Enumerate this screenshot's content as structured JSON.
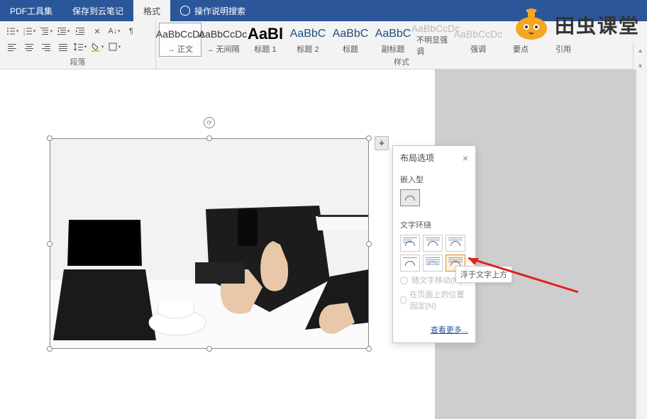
{
  "tabs": {
    "pdf_tools": "PDF工具集",
    "save_cloud": "保存到云笔记",
    "format": "格式",
    "search_placeholder": "操作说明搜索"
  },
  "ribbon": {
    "paragraph_label": "段落",
    "styles_label": "样式",
    "styles": [
      {
        "sample": "AaBbCcDc",
        "name": "→ 正文",
        "selected": true,
        "cls": ""
      },
      {
        "sample": "AaBbCcDc",
        "name": "→ 无间隔",
        "selected": false,
        "cls": ""
      },
      {
        "sample": "AaBl",
        "name": "标题 1",
        "selected": false,
        "cls": "big"
      },
      {
        "sample": "AaBbC",
        "name": "标题 2",
        "selected": false,
        "cls": "med"
      },
      {
        "sample": "AaBbC",
        "name": "标题",
        "selected": false,
        "cls": "med"
      },
      {
        "sample": "AaBbC",
        "name": "副标题",
        "selected": false,
        "cls": "med"
      },
      {
        "sample": "AaBbCcDc",
        "name": "不明显强调",
        "selected": false,
        "cls": "gray"
      },
      {
        "sample": "AaBbCcDc",
        "name": "强调",
        "selected": false,
        "cls": "gray"
      },
      {
        "sample": "",
        "name": "要点",
        "selected": false,
        "cls": "gray"
      },
      {
        "sample": "",
        "name": "引用",
        "selected": false,
        "cls": "gray"
      }
    ]
  },
  "layout_panel": {
    "title": "布局选项",
    "inline_label": "嵌入型",
    "wrap_label": "文字环绕",
    "tooltip": "浮于文字上方",
    "move_with_text": "随文字移动(M)",
    "fixed_position": "在页面上的位置固定(N)",
    "see_more": "查看更多..."
  },
  "watermark": {
    "text": "田虫课堂"
  }
}
